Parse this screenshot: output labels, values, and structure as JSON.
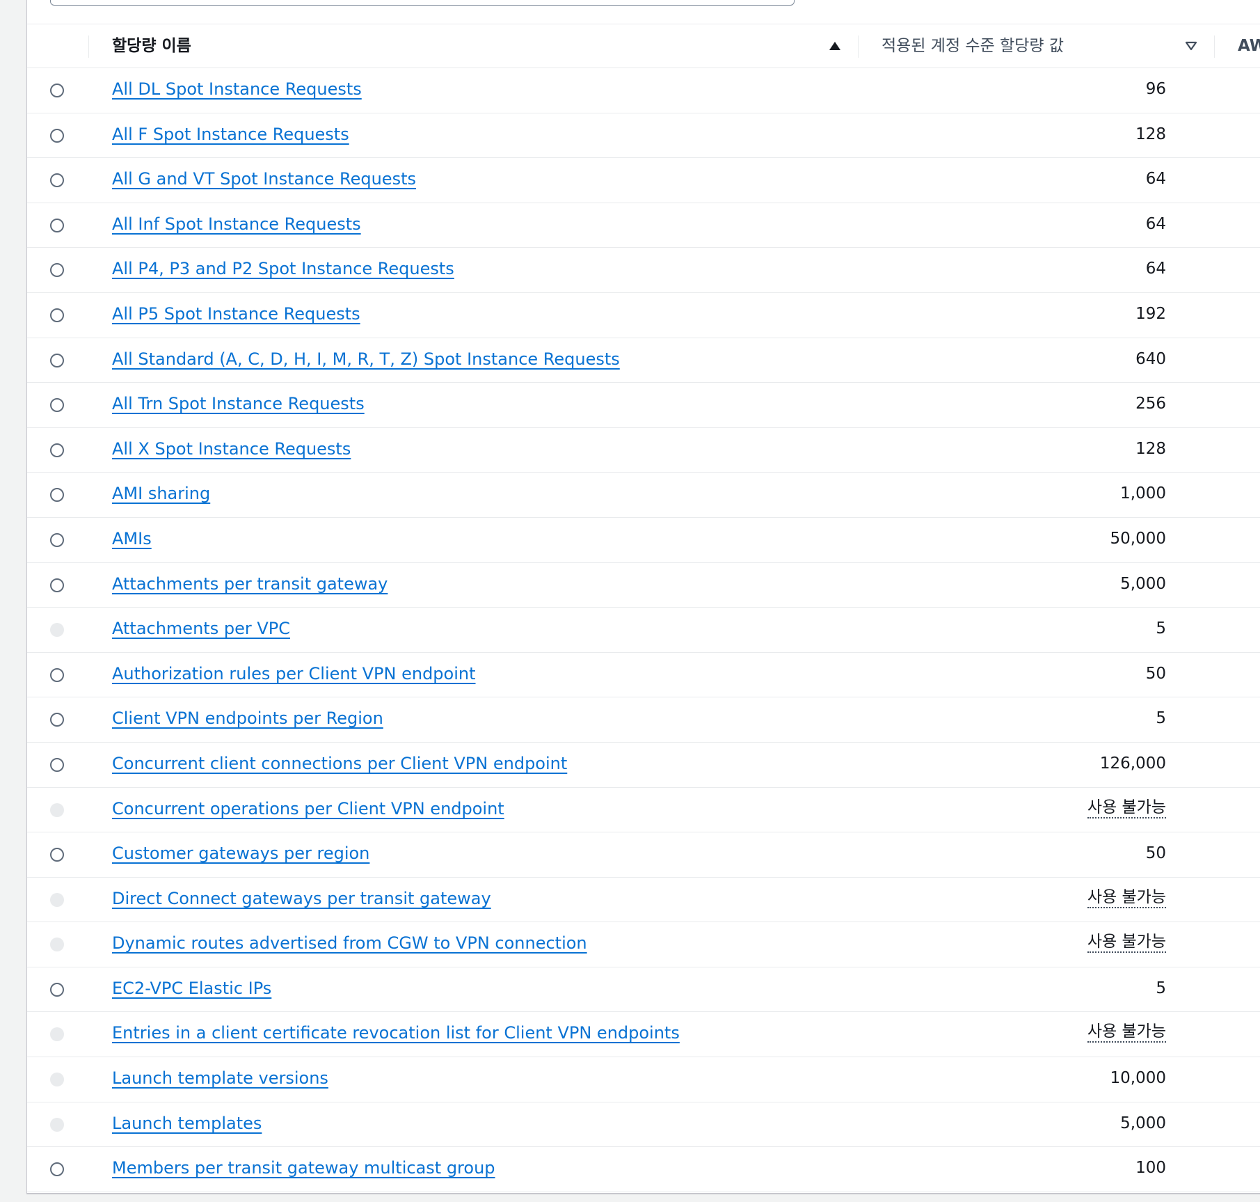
{
  "table": {
    "columns": {
      "quota_name": "할당량 이름",
      "applied_value": "적용된 계정 수준 할당량 값",
      "aws_default_partial": "AWS 기"
    },
    "sort_icons": {
      "quota_name": "sort-ascending-icon",
      "applied_value": "sort-descending-icon"
    },
    "rows": [
      {
        "name": "All DL Spot Instance Requests",
        "value": "96",
        "disabled": false
      },
      {
        "name": "All F Spot Instance Requests",
        "value": "128",
        "disabled": false
      },
      {
        "name": "All G and VT Spot Instance Requests",
        "value": "64",
        "disabled": false
      },
      {
        "name": "All Inf Spot Instance Requests",
        "value": "64",
        "disabled": false
      },
      {
        "name": "All P4, P3 and P2 Spot Instance Requests",
        "value": "64",
        "disabled": false
      },
      {
        "name": "All P5 Spot Instance Requests",
        "value": "192",
        "disabled": false
      },
      {
        "name": "All Standard (A, C, D, H, I, M, R, T, Z) Spot Instance Requests",
        "value": "640",
        "disabled": false
      },
      {
        "name": "All Trn Spot Instance Requests",
        "value": "256",
        "disabled": false
      },
      {
        "name": "All X Spot Instance Requests",
        "value": "128",
        "disabled": false
      },
      {
        "name": "AMI sharing",
        "value": "1,000",
        "disabled": false
      },
      {
        "name": "AMIs",
        "value": "50,000",
        "disabled": false
      },
      {
        "name": "Attachments per transit gateway",
        "value": "5,000",
        "disabled": false
      },
      {
        "name": "Attachments per VPC",
        "value": "5",
        "disabled": true
      },
      {
        "name": "Authorization rules per Client VPN endpoint",
        "value": "50",
        "disabled": false
      },
      {
        "name": "Client VPN endpoints per Region",
        "value": "5",
        "disabled": false
      },
      {
        "name": "Concurrent client connections per Client VPN endpoint",
        "value": "126,000",
        "disabled": false
      },
      {
        "name": "Concurrent operations per Client VPN endpoint",
        "value": "사용 불가능",
        "disabled": true,
        "unavailable": true
      },
      {
        "name": "Customer gateways per region",
        "value": "50",
        "disabled": false
      },
      {
        "name": "Direct Connect gateways per transit gateway",
        "value": "사용 불가능",
        "disabled": true,
        "unavailable": true
      },
      {
        "name": "Dynamic routes advertised from CGW to VPN connection",
        "value": "사용 불가능",
        "disabled": true,
        "unavailable": true
      },
      {
        "name": "EC2-VPC Elastic IPs",
        "value": "5",
        "disabled": false
      },
      {
        "name": "Entries in a client certificate revocation list for Client VPN endpoints",
        "value": "사용 불가능",
        "disabled": true,
        "unavailable": true
      },
      {
        "name": "Launch template versions",
        "value": "10,000",
        "disabled": true
      },
      {
        "name": "Launch templates",
        "value": "5,000",
        "disabled": true
      },
      {
        "name": "Members per transit gateway multicast group",
        "value": "100",
        "disabled": false
      }
    ]
  }
}
